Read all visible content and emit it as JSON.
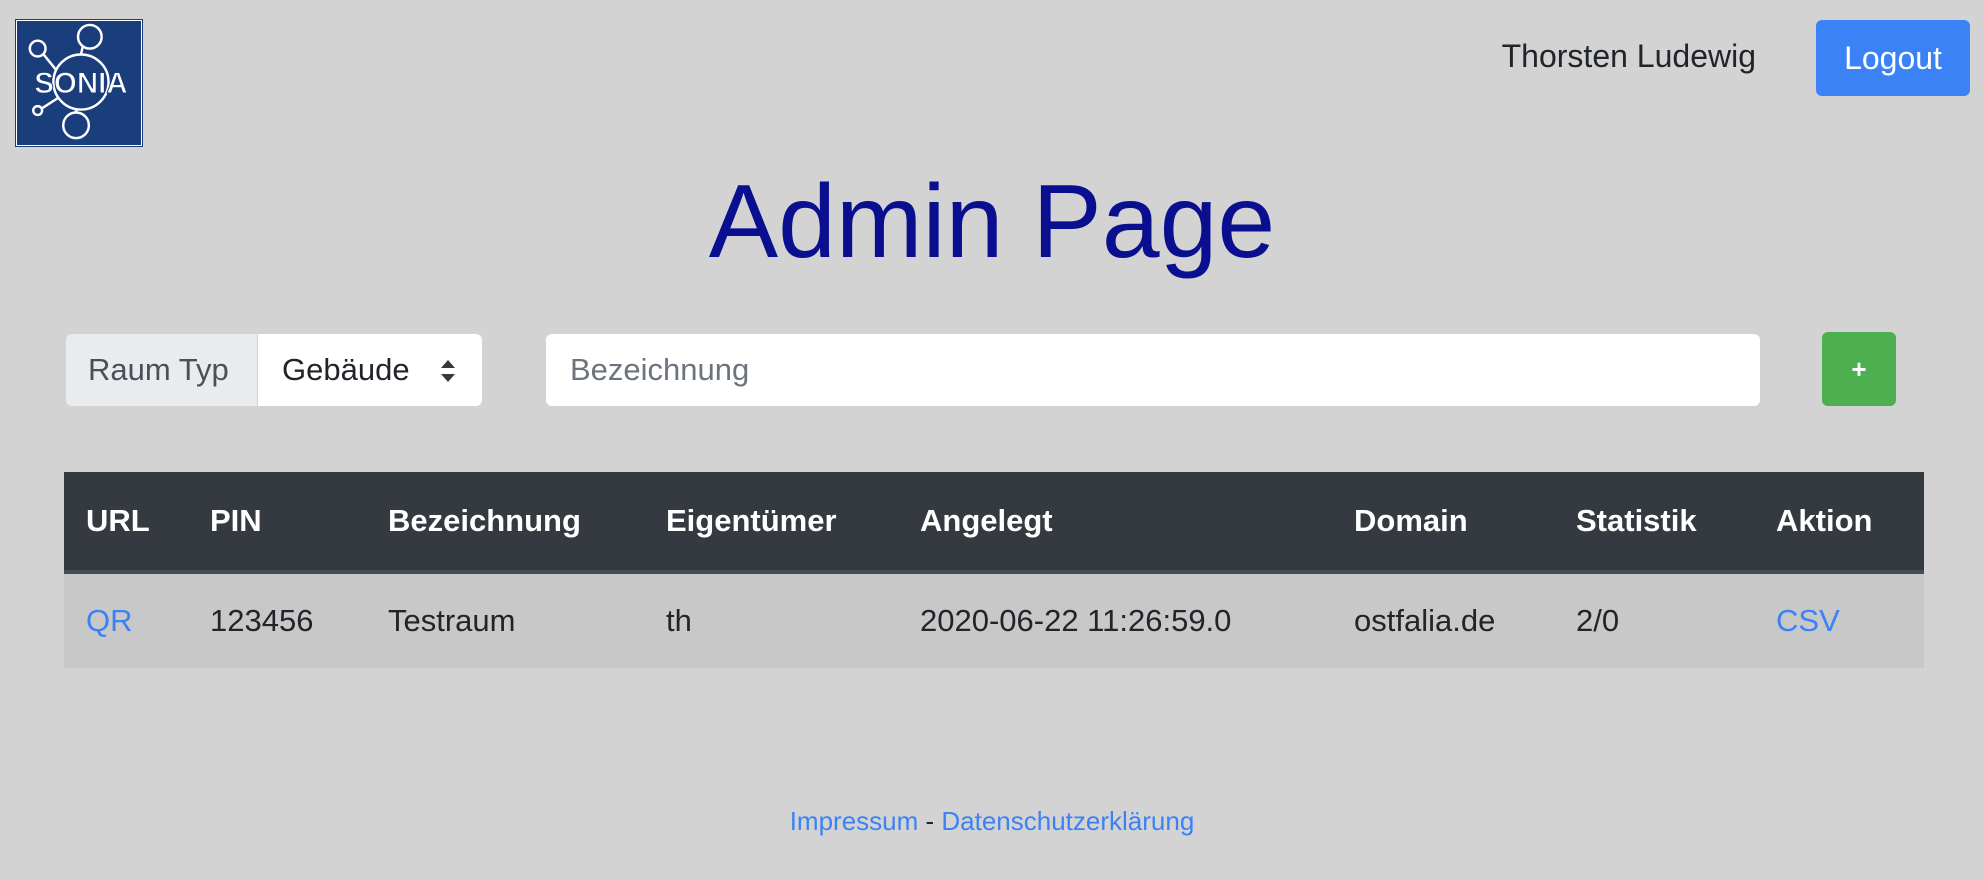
{
  "header": {
    "logo_text": "SONIA",
    "user_name": "Thorsten Ludewig",
    "logout_label": "Logout"
  },
  "page": {
    "title": "Admin Page"
  },
  "form": {
    "room_type_label": "Raum Typ",
    "room_type_selected": "Gebäude",
    "name_placeholder": "Bezeichnung",
    "add_label": "+"
  },
  "table": {
    "columns": [
      "URL",
      "PIN",
      "Bezeichnung",
      "Eigentümer",
      "Angelegt",
      "Domain",
      "Statistik",
      "Aktion"
    ],
    "rows": [
      {
        "url": "QR",
        "pin": "123456",
        "name": "Testraum",
        "owner": "th",
        "created": "2020-06-22 11:26:59.0",
        "domain": "ostfalia.de",
        "stats": "2/0",
        "action": "CSV"
      }
    ]
  },
  "footer": {
    "impressum": "Impressum",
    "separator": " - ",
    "privacy": "Datenschutzerklärung"
  },
  "colors": {
    "background": "#d3d3d3",
    "title": "#0a0f8f",
    "primary": "#3b82f6",
    "success": "#4caf50",
    "table_header": "#343a40",
    "logo_bg": "#1a3d7c"
  },
  "icons": {
    "logo": "sonia-network-logo",
    "select": "select-updown-arrows-icon"
  }
}
